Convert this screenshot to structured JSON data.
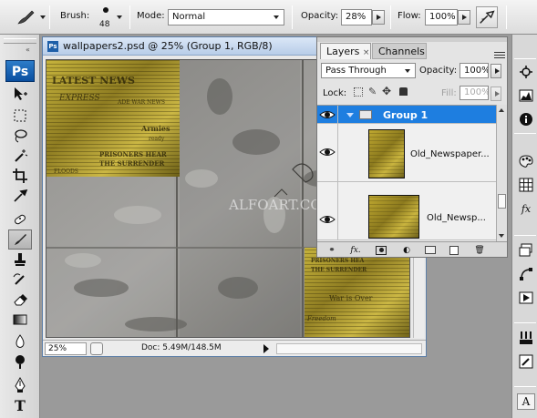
{
  "options_bar": {
    "brush_label": "Brush:",
    "brush_size": "48",
    "mode_label": "Mode:",
    "mode_value": "Normal",
    "opacity_label": "Opacity:",
    "opacity_value": "28%",
    "flow_label": "Flow:",
    "flow_value": "100%"
  },
  "tools": {
    "logo": "Ps",
    "active_tool": "brush",
    "items": [
      "move",
      "marquee",
      "lasso",
      "magic-wand",
      "crop",
      "eyedropper",
      "healing",
      "brush",
      "clone-stamp",
      "history-brush",
      "eraser",
      "gradient",
      "blur",
      "dodge",
      "pen",
      "type"
    ]
  },
  "document": {
    "title": "wallpapers2.psd @ 25% (Group 1, RGB/8)",
    "zoom": "25%",
    "doc_info": "Doc: 5.49M/148.5M",
    "watermark": "ALFOART.COM"
  },
  "canvas_text": {
    "latest_news": "LATEST NEWS",
    "express": "EXPRESS",
    "war_news": "ADE WAR NEWS",
    "armies": "Armies",
    "ready": "ready",
    "prisoners": "PRISONERS HEAR",
    "surrender": "THE SURRENDER",
    "floods": "FLOODS",
    "prisoners2": "PRISONERS HEA",
    "surrender2": "THE SURRENDER",
    "war_over": "War is Over",
    "freedom": "Freedom"
  },
  "layers_panel": {
    "tabs": [
      {
        "label": "Layers",
        "active": true,
        "close": "×"
      },
      {
        "label": "Channels",
        "active": false
      }
    ],
    "blend_mode": "Pass Through",
    "opacity_label": "Opacity:",
    "opacity_value": "100%",
    "lock_label": "Lock:",
    "fill_label": "Fill:",
    "fill_value": "100%",
    "layers": [
      {
        "name": "Group 1",
        "type": "group",
        "selected": true,
        "visible": true
      },
      {
        "name": "Old_Newspaper...",
        "type": "layer",
        "selected": false,
        "visible": true
      },
      {
        "name": "Old_Newsp...",
        "type": "layer",
        "selected": false,
        "visible": true
      }
    ],
    "footer": {
      "fx": "fx."
    }
  },
  "dock": {
    "items": [
      "navigator",
      "histogram",
      "info",
      "color",
      "swatches",
      "styles",
      "layers",
      "paths",
      "actions",
      "brushes",
      "tool-presets",
      "character"
    ]
  },
  "colors": {
    "selection": "#1e7ee0",
    "paper": "#b8a232",
    "concrete": "#878684"
  }
}
